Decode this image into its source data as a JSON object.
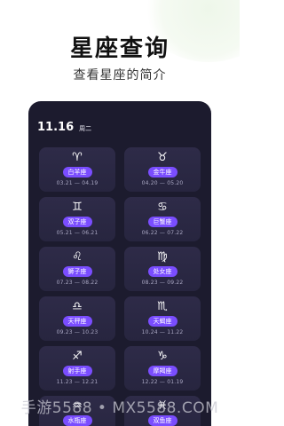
{
  "header": {
    "title": "星座查询",
    "subtitle": "查看星座的简介"
  },
  "phone": {
    "date": "11.16",
    "weekday": "周二",
    "signs": [
      {
        "symbol": "♈",
        "icon": "aries-icon",
        "name": "白羊座",
        "range": "03.21 — 04.19"
      },
      {
        "symbol": "♉",
        "icon": "taurus-icon",
        "name": "金牛座",
        "range": "04.20 — 05.20"
      },
      {
        "symbol": "♊",
        "icon": "gemini-icon",
        "name": "双子座",
        "range": "05.21 — 06.21"
      },
      {
        "symbol": "♋",
        "icon": "cancer-icon",
        "name": "巨蟹座",
        "range": "06.22 — 07.22"
      },
      {
        "symbol": "♌",
        "icon": "leo-icon",
        "name": "狮子座",
        "range": "07.23 — 08.22"
      },
      {
        "symbol": "♍",
        "icon": "virgo-icon",
        "name": "处女座",
        "range": "08.23 — 09.22"
      },
      {
        "symbol": "♎",
        "icon": "libra-icon",
        "name": "天秤座",
        "range": "09.23 — 10.23"
      },
      {
        "symbol": "♏",
        "icon": "scorpio-icon",
        "name": "天蝎座",
        "range": "10.24 — 11.22"
      },
      {
        "symbol": "♐",
        "icon": "sagittarius-icon",
        "name": "射手座",
        "range": "11.23 — 12.21"
      },
      {
        "symbol": "♑",
        "icon": "capricorn-icon",
        "name": "摩羯座",
        "range": "12.22 — 01.19"
      },
      {
        "symbol": "♒",
        "icon": "aquarius-icon",
        "name": "水瓶座"
      },
      {
        "symbol": "♓",
        "icon": "pisces-icon",
        "name": "双鱼座"
      }
    ]
  },
  "colors": {
    "phone_bg": "#1c1b2e",
    "card_bg": "#2e2b48",
    "accent": "#7a4dff"
  },
  "watermark": "手游5588 • MX5588.COM"
}
